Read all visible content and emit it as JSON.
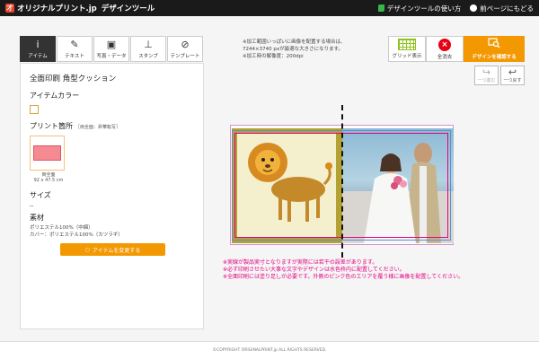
{
  "header": {
    "logo_mark": "才",
    "logo_text": "オリジナルプリント.jp",
    "logo_sub": "デザインツール",
    "link_howto": "デザインツールの使い方",
    "link_back": "前ページにもどる"
  },
  "tools": [
    {
      "label": "アイテム",
      "icon": "i"
    },
    {
      "label": "テキスト",
      "icon": "✎"
    },
    {
      "label": "写真・データ",
      "icon": "▣"
    },
    {
      "label": "スタンプ",
      "icon": "⊥"
    },
    {
      "label": "テンプレート",
      "icon": "⊘"
    }
  ],
  "notes": {
    "line1": "※加工範囲いっぱいに画像を配置する場合は、",
    "line2": "7244×3740 pxが最適な大きさになります。",
    "line3": "※加工時の解像度：200dpi"
  },
  "actions": {
    "grid_label": "グリッド表示",
    "delete_label": "全消去",
    "confirm_label": "デザインを確認する",
    "undo_label": "一つ進む",
    "redo_label": "一つ戻す",
    "delete_icon": "×"
  },
  "panel": {
    "title": "全面印刷 角型クッション",
    "color_heading": "アイテムカラー",
    "print_heading": "プリント箇所",
    "print_note": "［両全面：昇華転写］",
    "thumb_caption_1": "両全面",
    "thumb_caption_2": "92 x 47.5 cm",
    "size_heading": "サイズ",
    "size_value": "--",
    "material_heading": "素材",
    "material_line1": "ポリエステル100%（中綿）",
    "material_line2": "カバー：ポリエステル100%（カツラギ）",
    "change_button": "アイテムを変更する",
    "change_icon": "○"
  },
  "warnings": {
    "line1": "※実線が製品実寸となりますが実際には若干の誤差があります。",
    "line2": "※必ず印刷させたい大事な文字やデザインは水色枠内に配置してください。",
    "line3": "※全面印刷には塗り足しが必要です。外側のピンク色のエリアを覆う様に画像を配置してください。"
  },
  "footer": {
    "copyright": "©COPYRIGHT ORIGINALPRINT.jp ALL RIGHTS RESERVED."
  },
  "colors": {
    "accent": "#f39800",
    "warning_text": "#e50083",
    "safe_area": "#5d8fcf"
  }
}
